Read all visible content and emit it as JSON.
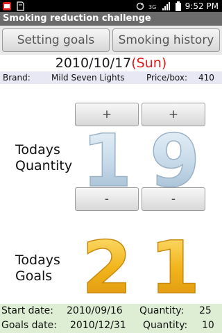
{
  "status": {
    "time": "9:52 PM"
  },
  "app": {
    "title": "Smoking reduction challenge"
  },
  "topbar": {
    "setting_goals": "Setting goals",
    "smoking_history": "Smoking history"
  },
  "date": {
    "value": "2010/10/17",
    "weekday": "(Sun)"
  },
  "brand": {
    "label": "Brand:",
    "name": "Mild Seven Lights",
    "price_label": "Price/box:",
    "price": "410"
  },
  "today_quantity": {
    "label_line1": "Todays",
    "label_line2": "Quantity",
    "digit1": "1",
    "digit2": "9",
    "plus": "+",
    "minus": "-"
  },
  "today_goals": {
    "label_line1": "Todays",
    "label_line2": "Goals",
    "digit1": "2",
    "digit2": "1"
  },
  "summary": {
    "start_label": "Start date:",
    "start_date": "2010/09/16",
    "start_qty_label": "Quantity:",
    "start_qty": "25",
    "goals_label": "Goals date:",
    "goals_date": "2010/12/31",
    "goals_qty_label": "Quantity:",
    "goals_qty": "10"
  },
  "colors": {
    "quantity_digits": "#c8dbea",
    "goals_digits": "#f2b51c",
    "weekday": "#e01818"
  }
}
